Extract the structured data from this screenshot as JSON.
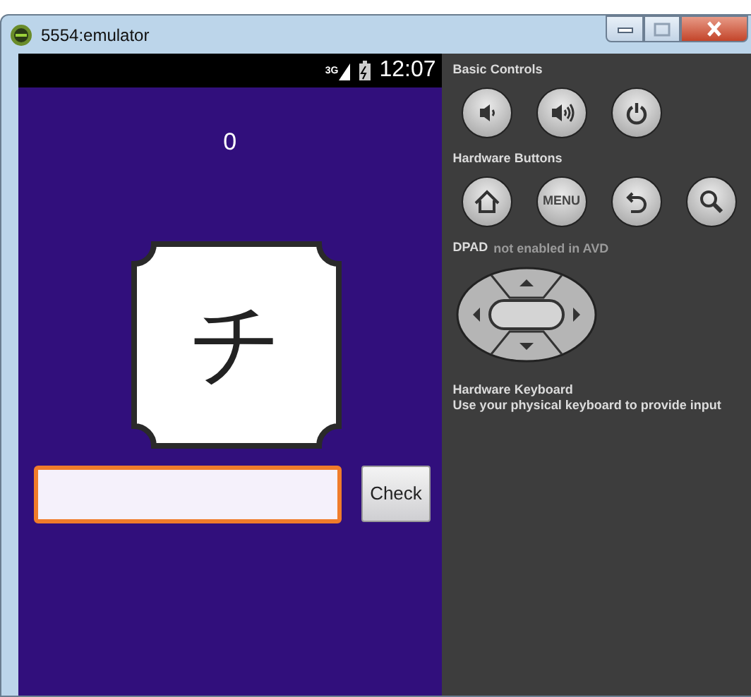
{
  "window": {
    "title": "5554:emulator"
  },
  "status_bar": {
    "network": "3G",
    "time": "12:07"
  },
  "app": {
    "score": "0",
    "card_character": "チ",
    "answer_field": {
      "focused": true
    },
    "check_button": "Check"
  },
  "controls_panel": {
    "sections": [
      {
        "kind": "buttons",
        "title": "Basic Controls",
        "buttons": [
          {
            "kind": "volume-down"
          },
          {
            "kind": "volume-up"
          },
          {
            "kind": "power"
          }
        ]
      },
      {
        "kind": "buttons",
        "title": "Hardware Buttons",
        "buttons": [
          {
            "kind": "home"
          },
          {
            "kind": "menu",
            "label": "MENU"
          },
          {
            "kind": "back"
          },
          {
            "kind": "search"
          }
        ]
      },
      {
        "kind": "dpad",
        "title": "DPAD",
        "note": "not enabled in AVD"
      },
      {
        "kind": "text",
        "title": "Hardware Keyboard",
        "text": "Use your physical keyboard to provide input"
      }
    ]
  }
}
